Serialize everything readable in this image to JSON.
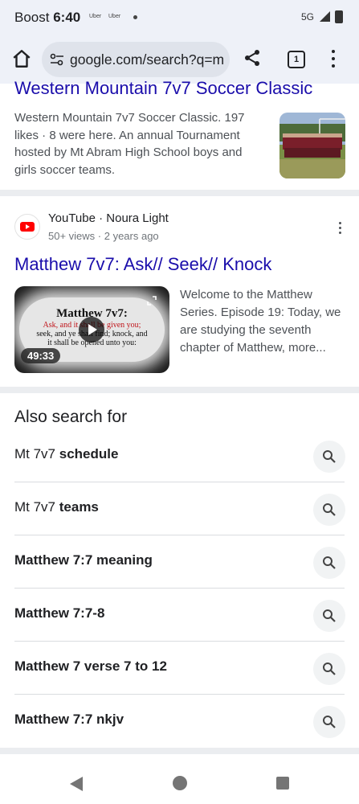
{
  "status_bar": {
    "carrier": "Boost",
    "time": "6:40",
    "notif_icons": [
      "Uber",
      "Uber"
    ],
    "network": "5G"
  },
  "toolbar": {
    "url": "google.com/search?q=m",
    "tab_count": "1"
  },
  "result1": {
    "title": "Western Mountain 7v7 Soccer Classic",
    "description": "Western Mountain 7v7 Soccer Classic. 197 likes · 8 were here. An annual Tournament hosted by Mt Abram High School boys and girls soccer teams."
  },
  "result2": {
    "site": "YouTube · Noura Light",
    "meta": "50+ views · 2 years ago",
    "title": "Matthew 7v7: Ask// Seek// Knock",
    "thumbnail": {
      "line1": "Matthew 7v7:",
      "line2": "Ask, and it shall be given you;",
      "line3": "seek, and ye shall find; knock, and",
      "line4": "it shall be opened unto you:",
      "duration": "49:33"
    },
    "description": "Welcome to the Matthew Series. Episode 19: Today, we are studying the seventh chapter of Matthew, more..."
  },
  "also_search": {
    "heading": "Also search for",
    "items": [
      {
        "prefix": "Mt 7v7 ",
        "bold": "schedule"
      },
      {
        "prefix": "Mt 7v7 ",
        "bold": "teams"
      },
      {
        "prefix": "",
        "bold": "Matthew 7:7 meaning"
      },
      {
        "prefix": "",
        "bold": "Matthew 7:7-8"
      },
      {
        "prefix": "",
        "bold": "Matthew 7 verse 7 to 12"
      },
      {
        "prefix": "",
        "bold": "Matthew 7:7 nkjv"
      }
    ]
  },
  "colors": {
    "link": "#1a0dab",
    "toolbar_bg": "#eef1f8",
    "youtube_red": "#ff0000"
  },
  "icons": [
    "home-icon",
    "tune-icon",
    "share-icon",
    "tabs-icon",
    "more-vert-icon",
    "play-icon",
    "fullscreen-icon",
    "search-icon",
    "back-icon",
    "home-nav-icon",
    "recents-icon"
  ]
}
